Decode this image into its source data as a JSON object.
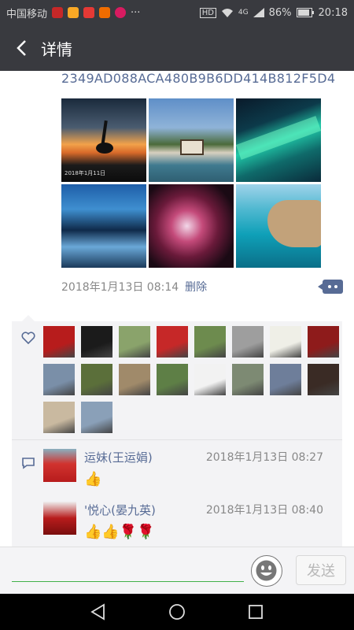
{
  "status_bar": {
    "carrier": "中国移动",
    "network": "HD",
    "signal": "4G",
    "battery": "86%",
    "time": "20:18",
    "dots": "···"
  },
  "header": {
    "title": "详情",
    "back_icon": "back-arrow-icon"
  },
  "post": {
    "hash_text": "2349AD088ACA480B9B6DD414B812F5D4",
    "images": [
      {
        "name": "sunset-crane-photo",
        "overlay_text": "2018年1月11日"
      },
      {
        "name": "waterside-village-photo",
        "overlay_text": ""
      },
      {
        "name": "aurora-photo",
        "overlay_text": ""
      },
      {
        "name": "ice-cave-photo",
        "overlay_text": ""
      },
      {
        "name": "nebula-photo",
        "overlay_text": ""
      },
      {
        "name": "sea-cliff-photo",
        "overlay_text": ""
      }
    ],
    "timestamp": "2018年1月13日 08:14",
    "delete_label": "删除"
  },
  "likes": {
    "icon": "heart-icon",
    "avatars": [
      "#b71c1c",
      "#1b1b1b",
      "#8aa36b",
      "#c62828",
      "#6d8b4e",
      "#9e9e9e",
      "#efefe7",
      "#8e1b1b",
      "#7a8fa8",
      "#5b6f3a",
      "#a08a6a",
      "#5e7f46",
      "#f2f2f2",
      "#7d8a73",
      "#6e7e9a",
      "#3a2b25",
      "#c9b9a0",
      "#8aa0b8"
    ]
  },
  "comments": {
    "icon": "comment-bubble-icon",
    "items": [
      {
        "name": "运妹(王运娟)",
        "time": "2018年1月13日 08:27",
        "text": "👍",
        "avatar_color": "#d1332f"
      },
      {
        "name": "'悦心(晏九英)",
        "time": "2018年1月13日 08:40",
        "text": "👍👍🌹🌹",
        "avatar_color": "#b71c1c"
      }
    ]
  },
  "input_bar": {
    "placeholder": "",
    "emoji_icon": "smiley-icon",
    "send_label": "发送"
  },
  "nav_bar": {
    "back": "nav-back-icon",
    "home": "nav-home-icon",
    "recents": "nav-recents-icon"
  },
  "colors": {
    "accent": "#576b95",
    "header_bg": "#393a3f",
    "panel_bg": "#f3f3f5",
    "input_line": "#42b04a"
  }
}
